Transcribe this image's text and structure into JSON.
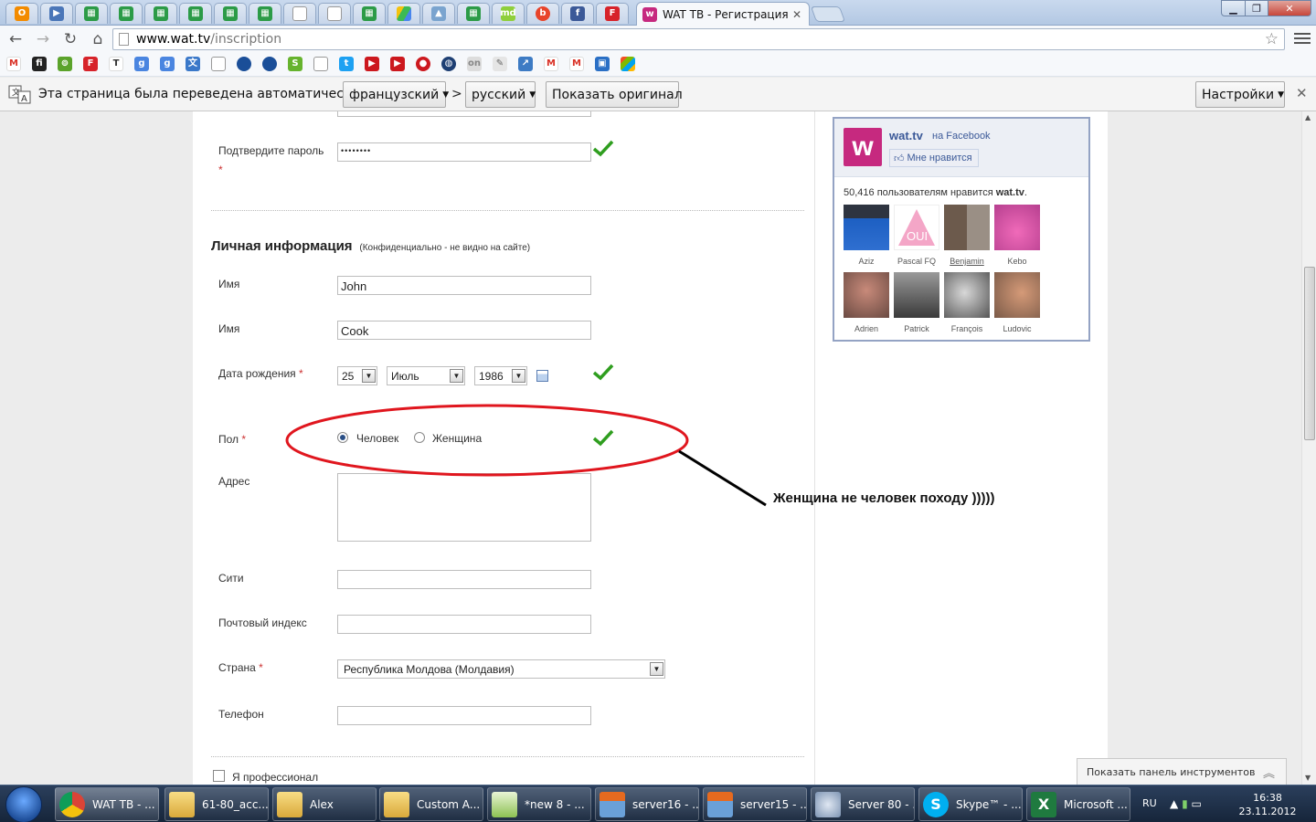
{
  "browser": {
    "active_tab_title": "WAT ТВ - Регистрация бе",
    "url_host": "www.wat.tv",
    "url_path": "/inscription"
  },
  "translate_bar": {
    "message": "Эта страница была переведена автоматически",
    "from_lang": "французский",
    "separator": ">",
    "to_lang": "русский",
    "show_original": "Показать оригинал",
    "settings": "Настройки"
  },
  "form": {
    "confirm_password_label": "Подтвердите пароль",
    "confirm_password_value": "••••••••",
    "required_mark": "*",
    "section_title": "Личная информация",
    "section_note": "(Конфиденциально - не видно на сайте)",
    "first_name_label": "Имя",
    "first_name_value": "John",
    "last_name_label": "Имя",
    "last_name_value": "Cook",
    "dob_label": "Дата рождения",
    "dob_day": "25",
    "dob_month": "Июль",
    "dob_year": "1986",
    "gender_label": "Пол",
    "gender_option_1": "Человек",
    "gender_option_2": "Женщина",
    "gender_selected": "Человек",
    "address_label": "Адрес",
    "city_label": "Сити",
    "postal_label": "Почтовый индекс",
    "country_label": "Страна",
    "country_value": "Республика Молдова (Молдавия)",
    "phone_label": "Телефон",
    "pro_label": "Я профессионал"
  },
  "facebook": {
    "site_name": "wat.tv",
    "on_facebook": "на Facebook",
    "like_button": "Мне нравится",
    "likes_prefix": "50,416 пользователям нравится",
    "likes_site": "wat.tv",
    "friends": [
      "Aziz",
      "Pascal FQ",
      "Benjamin",
      "Kebo",
      "Adrien",
      "Patrick",
      "François",
      "Ludovic"
    ],
    "logo_letter": "w"
  },
  "annotation": {
    "text": "Женщина не человек походу )))))"
  },
  "devtools_toggle": "Показать панель инструментов",
  "taskbar": {
    "tasks": [
      "WAT TB - ...",
      "61-80_acc...",
      "Alex",
      "Custom A...",
      "*new 8 - ...",
      "server16 - ...",
      "server15 - ...",
      "Server 80 - ...",
      "Skype™ - ...",
      "Microsoft ..."
    ],
    "lang": "RU",
    "time": "16:38",
    "date": "23.11.2012"
  },
  "colors": {
    "accent_red": "#e0161e",
    "check_green": "#2f9e1f",
    "fb_blue": "#3b5998",
    "wat_pink": "#c6297f"
  }
}
